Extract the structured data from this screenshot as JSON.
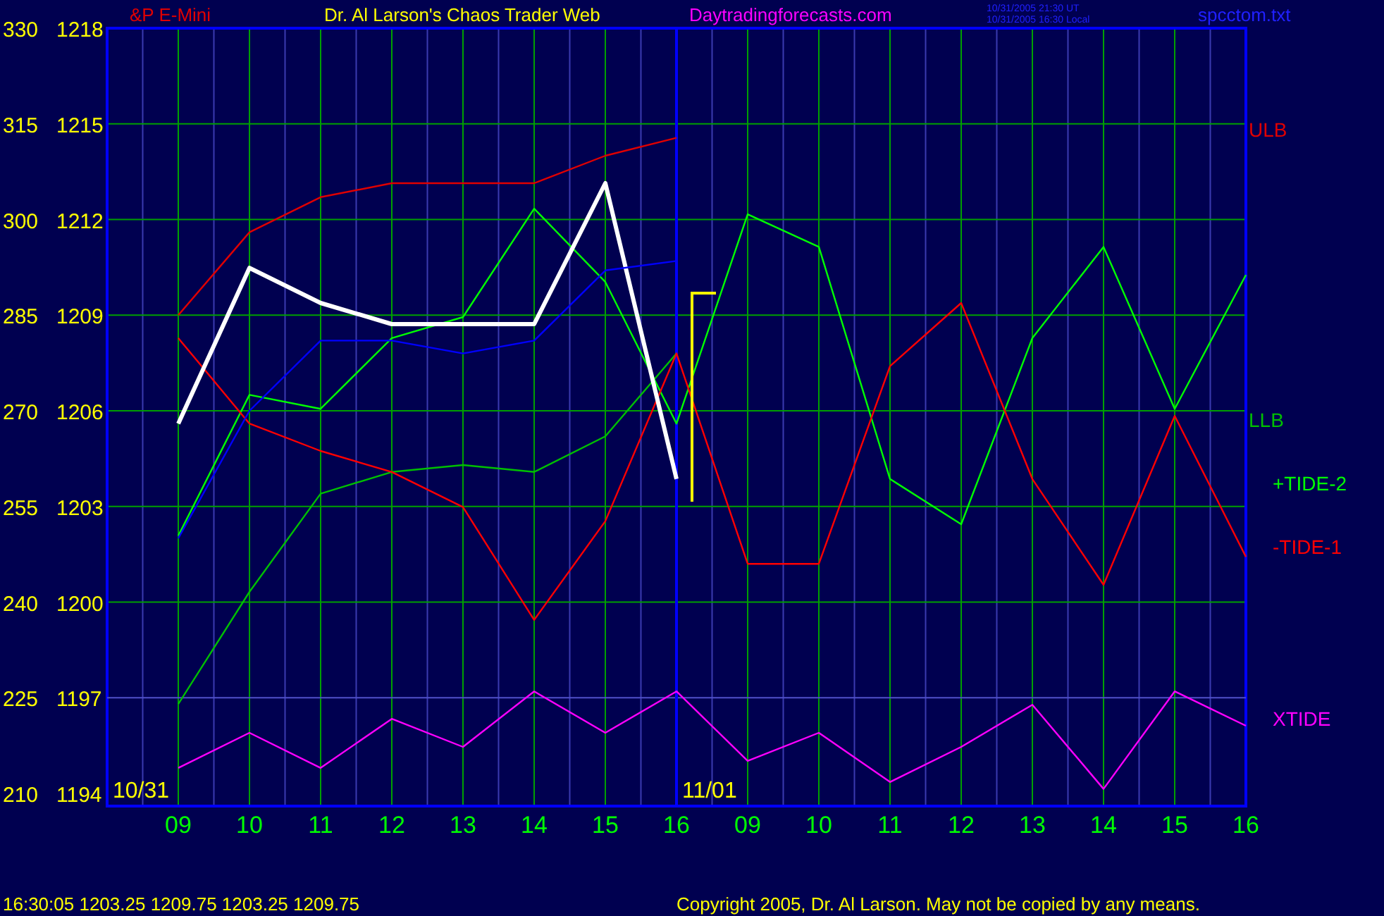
{
  "header": {
    "instrument": "&P E-Mini",
    "title": "Dr. Al Larson's Chaos Trader Web",
    "site": "Daytradingforecasts.com",
    "timestamps": [
      "10/31/2005 21:30 UT",
      "10/31/2005 16:30 Local"
    ],
    "file": "spcctom.txt"
  },
  "chart": {
    "price_ticks": [
      "1218",
      "1215",
      "1212",
      "1209",
      "1206",
      "1203",
      "1200",
      "1197",
      "1194"
    ],
    "dates": [
      "10/31",
      "11/01"
    ],
    "chart_data": {
      "type": "line",
      "grid": true,
      "categories": [
        "09",
        "10",
        "11",
        "12",
        "13",
        "14",
        "15",
        "16",
        "09",
        "10",
        "11",
        "12",
        "13",
        "14",
        "15",
        "16"
      ],
      "ylim": [
        210,
        330
      ],
      "ref_lines": [
        {
          "axis": "y",
          "value": 225,
          "color": "#5050c8"
        },
        {
          "axis": "x",
          "value": "16",
          "color": "#0000ff"
        }
      ],
      "yticks": [
        {
          "value": 330,
          "label": "330"
        },
        {
          "value": 315,
          "label": "315"
        },
        {
          "value": 300,
          "label": "300"
        },
        {
          "value": 285,
          "label": "285"
        },
        {
          "value": 270,
          "label": "270"
        },
        {
          "value": 255,
          "label": "255"
        },
        {
          "value": 240,
          "label": "240"
        },
        {
          "value": 225,
          "label": "225"
        },
        {
          "value": 210,
          "label": "210"
        }
      ],
      "series": [
        {
          "name": "ULB",
          "color": "#e00000",
          "values": [
            285,
            298,
            303.5,
            305.7,
            305.7,
            305.7,
            310,
            312.8,
            null,
            null,
            null,
            null,
            null,
            null,
            null,
            null
          ]
        },
        {
          "name": "LLB",
          "color": "#00c000",
          "values": [
            224,
            241.6,
            257,
            260.4,
            261.5,
            260.4,
            266,
            279,
            null,
            null,
            null,
            null,
            null,
            null,
            null,
            null
          ]
        },
        {
          "name": "+TIDE-2",
          "color": "#00ff00",
          "values": [
            250.4,
            272.5,
            270.3,
            281.4,
            284.7,
            301.7,
            290.2,
            268,
            300.8,
            295.7,
            259.3,
            252.2,
            281.4,
            295.7,
            270.3,
            291.3
          ]
        },
        {
          "name": "-TIDE-1",
          "color": "#ff0000",
          "values": [
            281.4,
            268,
            263.7,
            260.4,
            254.9,
            237.2,
            252.7,
            279,
            246,
            246,
            277,
            286.9,
            259.3,
            242.7,
            269.2,
            247.1
          ]
        },
        {
          "name": "XTIDE",
          "color": "#ff00ff",
          "values": [
            214,
            219.5,
            214,
            221.7,
            217.3,
            226,
            219.5,
            226,
            215.1,
            219.5,
            211.8,
            217.3,
            223.9,
            210.7,
            226,
            220.6
          ]
        },
        {
          "color": "#ffffff",
          "values": [
            268,
            292.4,
            286.9,
            283.6,
            283.6,
            283.6,
            305.7,
            259.3,
            null,
            null,
            null,
            null,
            null,
            null,
            null,
            null
          ]
        },
        {
          "color": "#0000ff",
          "values": [
            250,
            270,
            281,
            281,
            279,
            281,
            292,
            293.5,
            null,
            null,
            null,
            null,
            null,
            null,
            null,
            null
          ]
        }
      ]
    }
  },
  "status": {
    "quote": "16:30:05  1203.25 1209.75 1203.25 1209.75",
    "copyright": "Copyright 2005, Dr. Al Larson. May not be copied by any means."
  }
}
